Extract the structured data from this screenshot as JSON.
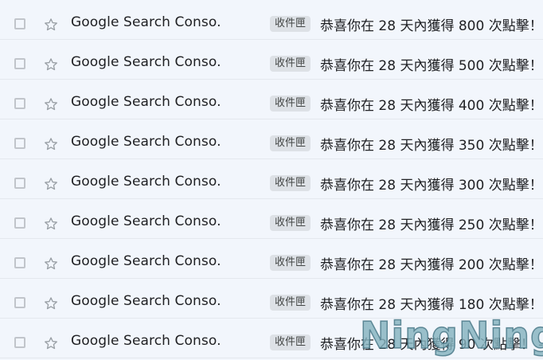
{
  "emails": [
    {
      "sender": "Google Search Conso.",
      "label": "收件匣",
      "subject": "恭喜你在 28 天內獲得 800 次點擊！"
    },
    {
      "sender": "Google Search Conso.",
      "label": "收件匣",
      "subject": "恭喜你在 28 天內獲得 500 次點擊！"
    },
    {
      "sender": "Google Search Conso.",
      "label": "收件匣",
      "subject": "恭喜你在 28 天內獲得 400 次點擊！"
    },
    {
      "sender": "Google Search Conso.",
      "label": "收件匣",
      "subject": "恭喜你在 28 天內獲得 350 次點擊！"
    },
    {
      "sender": "Google Search Conso.",
      "label": "收件匣",
      "subject": "恭喜你在 28 天內獲得 300 次點擊！"
    },
    {
      "sender": "Google Search Conso.",
      "label": "收件匣",
      "subject": "恭喜你在 28 天內獲得 250 次點擊！"
    },
    {
      "sender": "Google Search Conso.",
      "label": "收件匣",
      "subject": "恭喜你在 28 天內獲得 200 次點擊！"
    },
    {
      "sender": "Google Search Conso.",
      "label": "收件匣",
      "subject": "恭喜你在 28 天內獲得 180 次點擊！ -"
    },
    {
      "sender": "Google Search Conso.",
      "label": "收件匣",
      "subject": "恭喜你在 28 天內獲得 90 次點擊！ -"
    }
  ],
  "watermark": "NingNing"
}
